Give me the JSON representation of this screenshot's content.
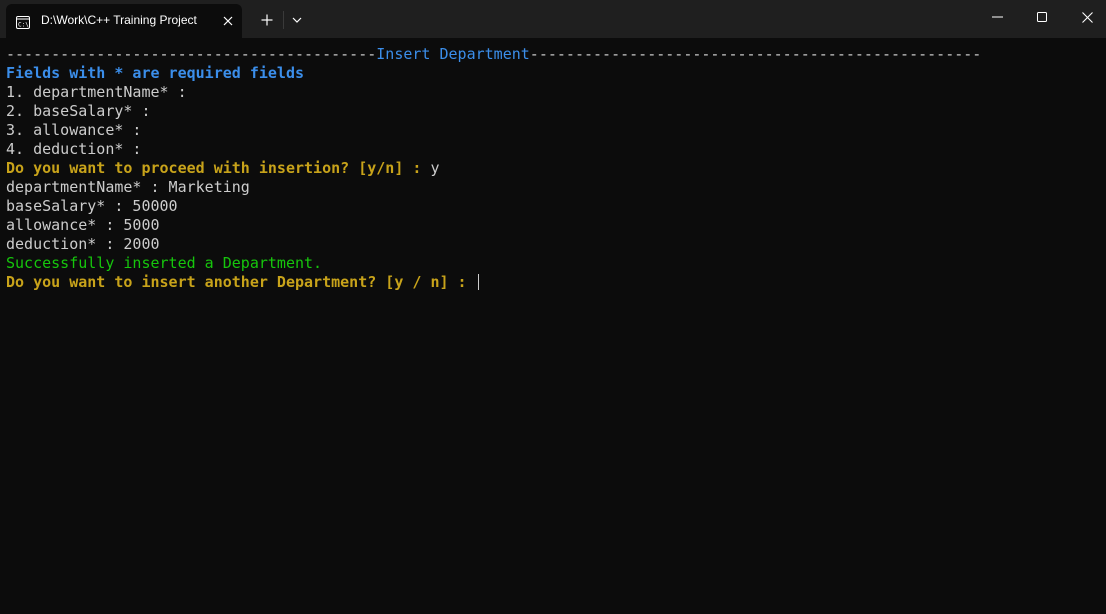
{
  "window": {
    "tab_title": "D:\\Work\\C++ Training Project",
    "tab_icon": "terminal-icon",
    "new_tab_icon": "plus-icon",
    "dropdown_icon": "chevron-down-icon",
    "minimize_icon": "minimize-icon",
    "maximize_icon": "maximize-icon",
    "close_icon": "close-icon"
  },
  "colors": {
    "background": "#0c0c0c",
    "titlebar": "#1f1f1f",
    "text": "#cccccc",
    "blue": "#3b8eea",
    "yellow": "#c8a31a",
    "green": "#16c60c"
  },
  "terminal": {
    "header_left": "-----------------------------------------",
    "header_title": "Insert Department",
    "header_right": "--------------------------------------------------",
    "required_note": "Fields with * are required fields",
    "fields": [
      "1. departmentName* :",
      "2. baseSalary* :",
      "3. allowance* :",
      "4. deduction* :"
    ],
    "proceed_prompt": "Do you want to proceed with insertion? [y/n] :",
    "proceed_answer": "y",
    "entries": [
      "departmentName* : Marketing",
      "baseSalary* : 50000",
      "allowance* : 5000",
      "deduction* : 2000"
    ],
    "success_message": "Successfully inserted a Department.",
    "another_prompt": "Do you want to insert another Department? [y / n] :"
  }
}
